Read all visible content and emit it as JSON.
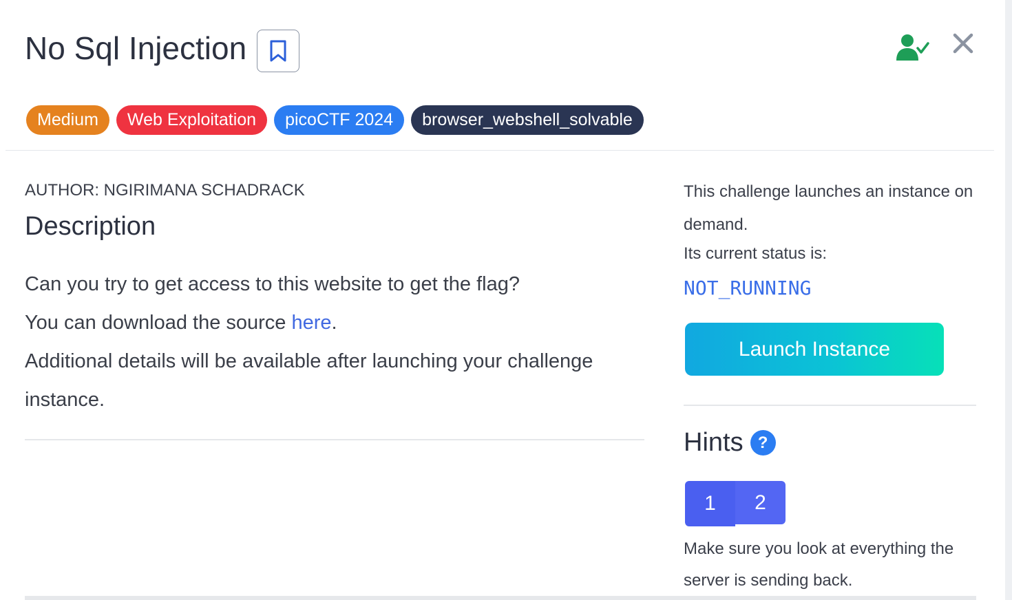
{
  "challenge": {
    "title": "No Sql Injection",
    "tags": [
      "Medium",
      "Web Exploitation",
      "picoCTF 2024",
      "browser_webshell_solvable"
    ],
    "author": "AUTHOR: NGIRIMANA SCHADRACK"
  },
  "description": {
    "heading": "Description",
    "line1": "Can you try to get access to this website to get the flag?",
    "line2_prefix": "You can download the source ",
    "line2_link": "here",
    "line2_suffix": ".",
    "line3": "Additional details will be available after launching your challenge instance."
  },
  "instance": {
    "info_line1": "This challenge launches an instance on demand.",
    "info_line2": "Its current status is:",
    "status": "NOT_RUNNING",
    "launch_label": "Launch Instance"
  },
  "hints": {
    "heading": "Hints",
    "help_glyph": "?",
    "tabs": [
      "1",
      "2"
    ],
    "active_text": "Make sure you look at everything the server is sending back."
  },
  "colors": {
    "medium": "#e5821f",
    "category": "#ef3340",
    "event": "#2b7df2",
    "extra": "#2a3553",
    "status": "#3a6ee8",
    "solved_icon": "#1e9e57"
  }
}
